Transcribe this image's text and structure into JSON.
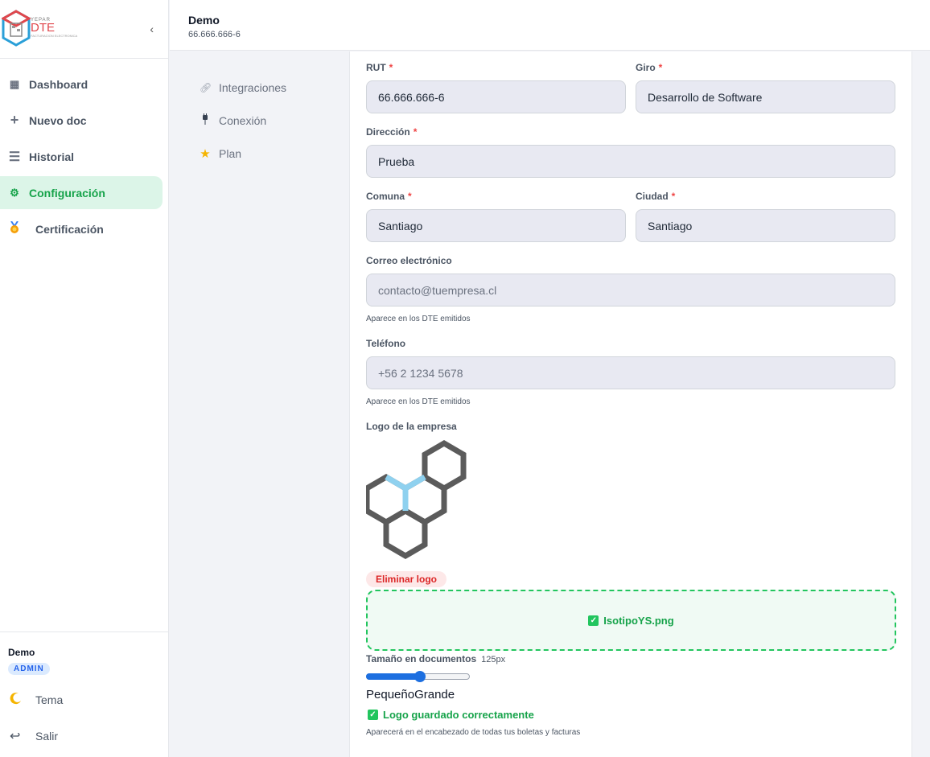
{
  "brand": {
    "small_text": "YEPAR",
    "name": "DTE",
    "tagline": "FACTURACION ELECTRONICA",
    "colors": {
      "accent_red": "#e0474c",
      "accent_blue": "#2a9fd8"
    }
  },
  "sidebar": {
    "collapse_label": "‹",
    "items": [
      {
        "label": "Dashboard",
        "icon": "grid-icon",
        "active": false
      },
      {
        "label": "Nuevo doc",
        "icon": "plus-icon",
        "active": false
      },
      {
        "label": "Historial",
        "icon": "list-icon",
        "active": false
      },
      {
        "label": "Configuración",
        "icon": "gear-icon",
        "active": true
      },
      {
        "label": "Certificación",
        "icon": "medal-icon",
        "active": false
      }
    ],
    "user": {
      "name": "Demo",
      "role": "ADMIN"
    },
    "footer": [
      {
        "label": "Tema",
        "icon": "moon-icon"
      },
      {
        "label": "Salir",
        "icon": "logout-icon"
      }
    ]
  },
  "header": {
    "company_name": "Demo",
    "company_rut": "66.666.666-6"
  },
  "settings_nav": [
    {
      "label": "Integraciones",
      "icon": "link-icon"
    },
    {
      "label": "Conexión",
      "icon": "plug-icon"
    },
    {
      "label": "Plan",
      "icon": "star-icon"
    }
  ],
  "form": {
    "rut": {
      "label": "RUT",
      "required_mark": "*",
      "value": "66.666.666-6"
    },
    "giro": {
      "label": "Giro",
      "required_mark": "*",
      "value": "Desarrollo de Software"
    },
    "direccion": {
      "label": "Dirección",
      "required_mark": "*",
      "value": "Prueba"
    },
    "comuna": {
      "label": "Comuna",
      "required_mark": "*",
      "value": "Santiago"
    },
    "ciudad": {
      "label": "Ciudad",
      "required_mark": "*",
      "value": "Santiago"
    },
    "email": {
      "label": "Correo electrónico",
      "value": "",
      "placeholder": "contacto@tuempresa.cl",
      "help": "Aparece en los DTE emitidos"
    },
    "telefono": {
      "label": "Teléfono",
      "value": "",
      "placeholder": "+56 2 1234 5678",
      "help": "Aparece en los DTE emitidos"
    },
    "logo": {
      "label": "Logo de la empresa",
      "delete_label": "Eliminar logo",
      "file_name": "IsotipoYS.png",
      "size_label": "Tamaño en documentos",
      "size_value": "125px",
      "size_fraction": 0.52,
      "scale_min_label": "Pequeño",
      "scale_max_label": "Grande",
      "saved_message": "Logo guardado correctamente",
      "footer_help": "Aparecerá en el encabezado de todas tus boletas y facturas",
      "colors": {
        "hex": "#5b5b5b",
        "accent": "#8fd1ef"
      }
    }
  },
  "colors": {
    "active_green": "#16a34a",
    "slider_blue": "#1d6fe0",
    "danger_red": "#dc2626"
  }
}
